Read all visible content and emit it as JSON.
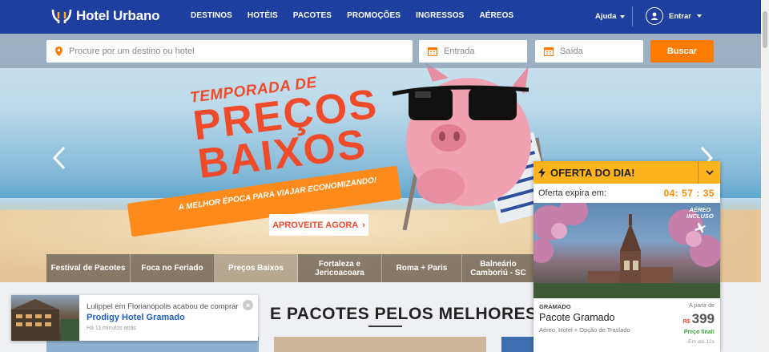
{
  "brand": {
    "name": "Hotel Urbano"
  },
  "nav": [
    "DESTINOS",
    "HOTÉIS",
    "PACOTES",
    "PROMOÇÕES",
    "INGRESSOS",
    "AÉREOS"
  ],
  "header": {
    "help": "Ajuda",
    "login": "Entrar"
  },
  "search": {
    "destination_placeholder": "Procure por um destino ou hotel",
    "checkin_placeholder": "Entrada",
    "checkout_placeholder": "Saída",
    "button": "Buscar"
  },
  "hero": {
    "line1": "TEMPORADA DE",
    "line2": "PREÇOS",
    "line3": "BAIXOS",
    "tagline": "A MELHOR ÉPOCA PARA VIAJAR ECONOMIZANDO!",
    "cta": "APROVEITE AGORA"
  },
  "categories": [
    "Festival de Pacotes",
    "Foca no Feriado",
    "Preços Baixos",
    "Fortaleza e Jericoacoara",
    "Roma + Paris",
    "Balneário Camboriú - SC"
  ],
  "section": {
    "title": "E PACOTES PELOS MELHORES PRE"
  },
  "notification": {
    "message": "Lulippel em Florianópolis acabou de comprar",
    "hotel": "Prodigy Hotel Gramado",
    "time": "Há 11 minutos atrás",
    "close": "×"
  },
  "deal": {
    "header": "OFERTA DO DIA!",
    "expire_label": "Oferta expira em:",
    "timer": "04: 57 : 35",
    "badge_line1": "AÉREO",
    "badge_line2": "INCLUSO",
    "destination": "GRAMADO",
    "name": "Pacote Gramado",
    "description": "Aéreo, Hotel + Opção de Traslado",
    "from_label": "A partir de",
    "currency": "R$",
    "price": "399",
    "final_label": "Preço final!",
    "installments": "Em até 12x"
  },
  "colors": {
    "header": "#1f3fa0",
    "accent": "#ff7a00",
    "deal": "#ffb41e",
    "promo": "#ef4b2b"
  }
}
